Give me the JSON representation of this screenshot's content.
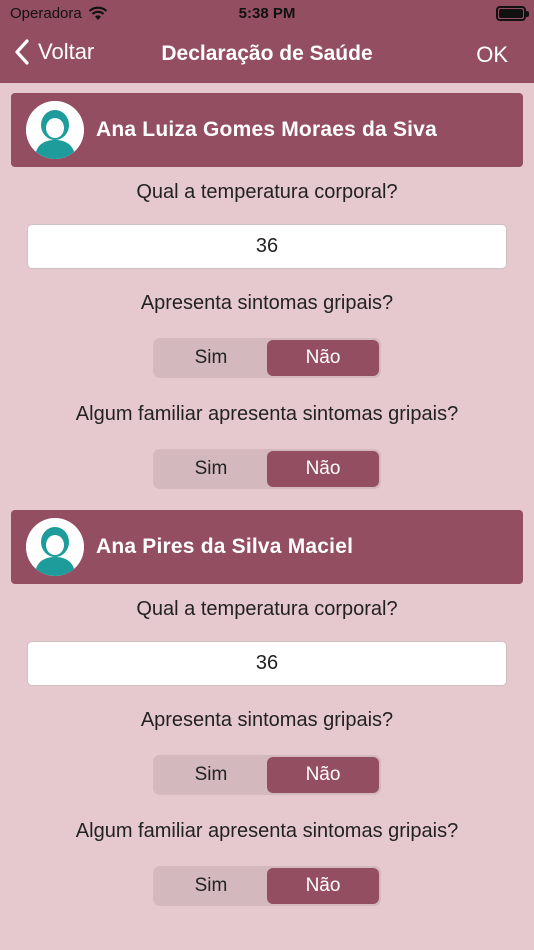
{
  "status_bar": {
    "carrier": "Operadora",
    "time": "5:38 PM"
  },
  "nav": {
    "back_label": "Voltar",
    "title": "Declaração de Saúde",
    "confirm_label": "OK"
  },
  "persons": [
    {
      "name": "Ana Luiza Gomes Moraes da Siva",
      "temperature_question": "Qual a temperatura corporal?",
      "temperature_value": "36",
      "flu_question": "Apresenta sintomas gripais?",
      "family_question": "Algum familiar apresenta sintomas gripais?",
      "flu_options": [
        "Sim",
        "Não"
      ],
      "flu_selected": "Não",
      "family_options": [
        "Sim",
        "Não"
      ],
      "family_selected": "Não"
    },
    {
      "name": "Ana Pires da Silva Maciel",
      "temperature_question": "Qual a temperatura corporal?",
      "temperature_value": "36",
      "flu_question": "Apresenta sintomas gripais?",
      "family_question": "Algum familiar apresenta sintomas gripais?",
      "flu_options": [
        "Sim",
        "Não"
      ],
      "flu_selected": "Não",
      "family_options": [
        "Sim",
        "Não"
      ],
      "family_selected": "Não"
    }
  ],
  "colors": {
    "accent": "#944e62",
    "background": "#e6c9cf",
    "segment_bg": "#d3b8be",
    "avatar": "#1e9b9b"
  }
}
